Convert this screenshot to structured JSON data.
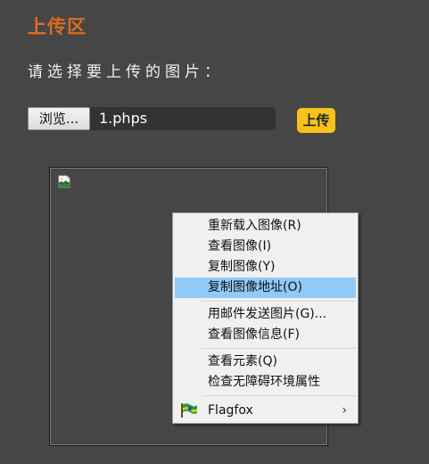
{
  "section": {
    "title": "上传区",
    "prompt": "请选择要上传的图片："
  },
  "file_input": {
    "browse_label": "浏览...",
    "file_name": "1.phps"
  },
  "upload_button": {
    "label": "上传"
  },
  "preview": {
    "icon": "broken-image-icon"
  },
  "context_menu": {
    "items": [
      {
        "label": "重新载入图像(R)"
      },
      {
        "label": "查看图像(I)"
      },
      {
        "label": "复制图像(Y)"
      },
      {
        "label": "复制图像地址(O)",
        "highlighted": true
      },
      {
        "label": "用邮件发送图片(G)..."
      },
      {
        "label": "查看图像信息(F)"
      },
      {
        "label": "查看元素(Q)"
      },
      {
        "label": "检查无障碍环境属性"
      },
      {
        "label": "Flagfox",
        "icon": "flagfox-icon",
        "has_submenu": true
      }
    ],
    "submenu_arrow": "›"
  },
  "colors": {
    "background": "#464646",
    "title": "#e06a1e",
    "upload_button": "#f7c21b",
    "menu_highlight": "#91c9f7"
  }
}
